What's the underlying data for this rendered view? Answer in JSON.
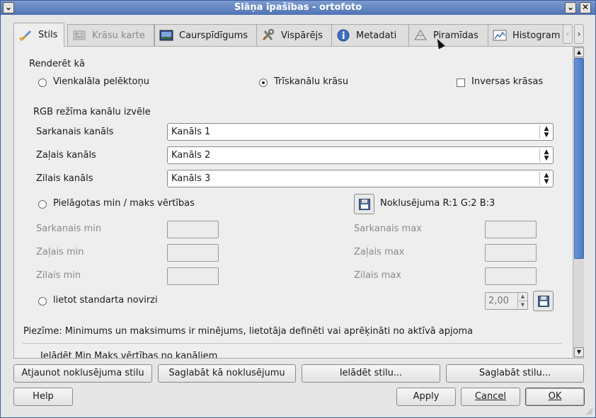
{
  "window": {
    "title": "Slāņa īpašības - ortofoto"
  },
  "tabs": [
    {
      "label": "Stils",
      "icon": "brush-icon"
    },
    {
      "label": "Krāsu karte",
      "icon": "colormap-icon"
    },
    {
      "label": "Caurspīdīgums",
      "icon": "transparency-icon"
    },
    {
      "label": "Vispārējs",
      "icon": "tools-icon"
    },
    {
      "label": "Metadati",
      "icon": "info-icon"
    },
    {
      "label": "Piramīdas",
      "icon": "pyramid-icon"
    },
    {
      "label": "Histogram",
      "icon": "histogram-icon"
    }
  ],
  "style": {
    "render_as_label": "Renderēt kā",
    "grayscale_label": "Vienkalāla pelēktoņu",
    "three_band_label": "Trīskanālu krāsu",
    "invert_label": "Inversas krāsas",
    "rgb_section_label": "RGB režīma kanālu izvēle",
    "red_band_label": "Sarkanais kanāls",
    "green_band_label": "Zaļais kanāls",
    "blue_band_label": "Zilais kanāls",
    "red_band_value": "Kanāls 1",
    "green_band_value": "Kanāls 2",
    "blue_band_value": "Kanāls 3",
    "custom_minmax_label": "Pielāgotas min / maks vērtības",
    "default_rgb_label": "Noklusējuma R:1 G:2 B:3",
    "red_min_label": "Sarkanais min",
    "green_min_label": "Zaļais min",
    "blue_min_label": "Zilais min",
    "red_max_label": "Sarkanais max",
    "green_max_label": "Zaļais max",
    "blue_max_label": "Zilais max",
    "stddev_label": "lietot standarta novirzi",
    "stddev_value": "2,00",
    "note": "Piezīme: Minimums un maksimums ir minējums, lietotāja definēti vai aprēķināti no aktīvā apjoma",
    "load_minmax_label": "Ielādēt Min Maks vērtības no kanāliem"
  },
  "buttons": {
    "restore_default": "Atjaunot noklusējuma stilu",
    "save_as_default": "Saglabāt kā noklusējumu",
    "load_style": "Ielādēt stilu...",
    "save_style": "Saglabāt stilu...",
    "help": "Help",
    "apply": "Apply",
    "cancel": "Cancel",
    "ok": "OK"
  },
  "colors": {
    "titlebar": "#4e72b4",
    "scroll_thumb": "#5a86cf"
  }
}
